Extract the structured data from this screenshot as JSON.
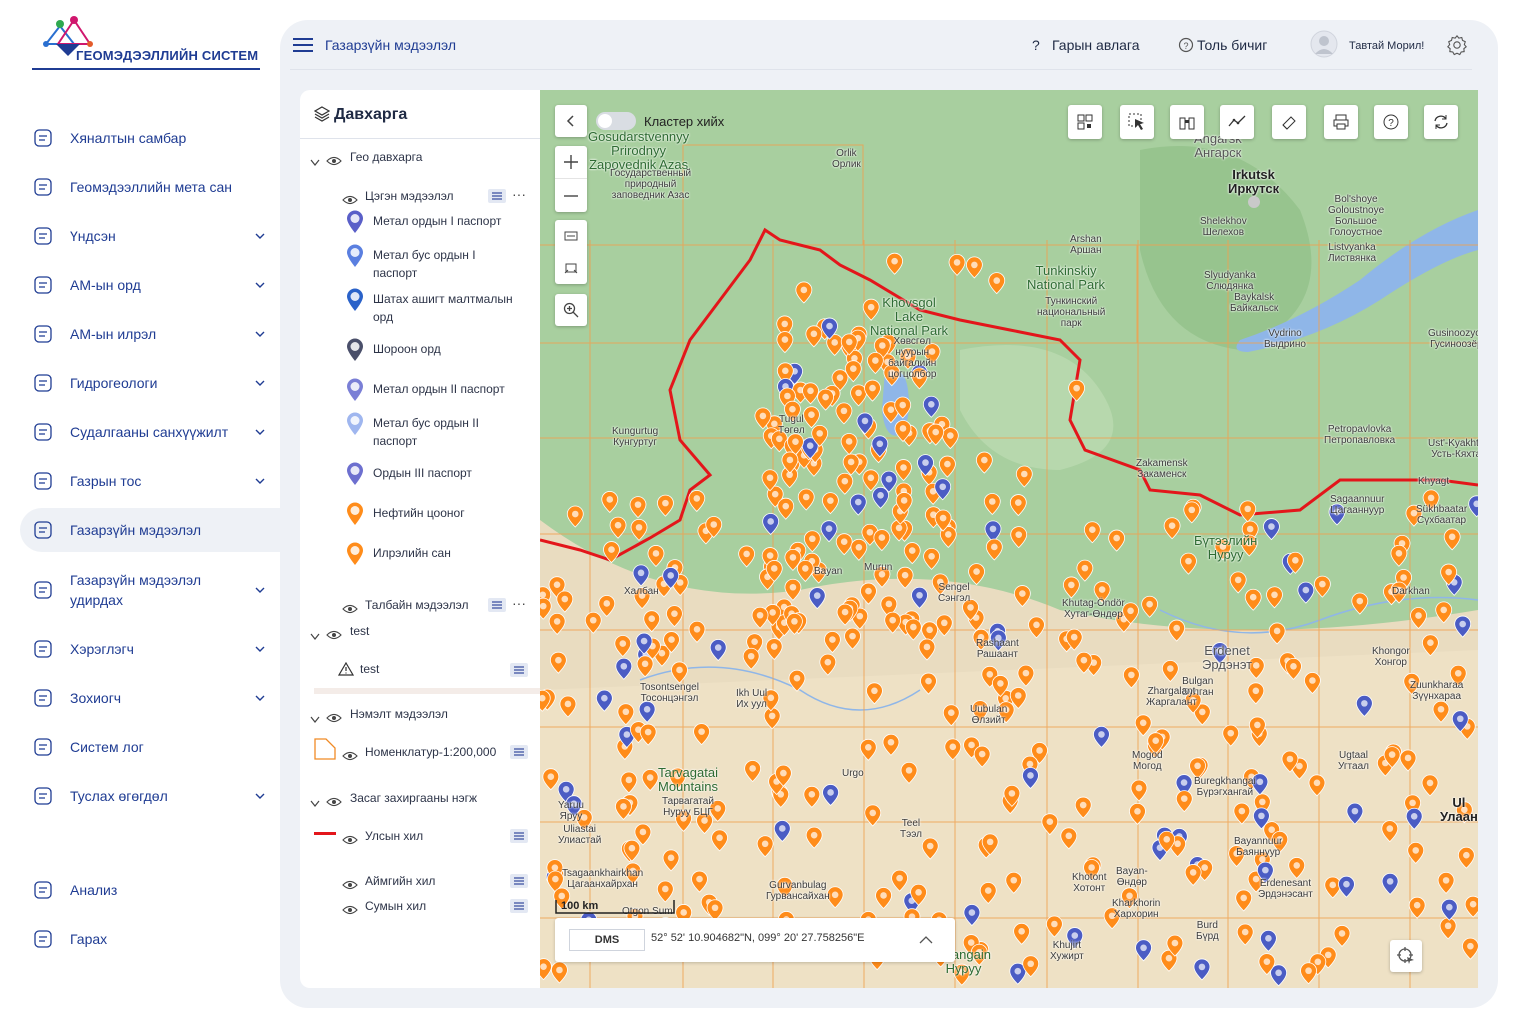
{
  "app": {
    "logo_text": "ГЕОМЭДЭЭЛЛИЙН СИСТЕМ"
  },
  "sidebar": {
    "items": [
      {
        "label": "Хяналтын самбар",
        "icon": "dashboard-icon",
        "chevron": false
      },
      {
        "label": "Геомэдээллийн мета сан",
        "icon": "database-icon",
        "chevron": false
      },
      {
        "label": "Үндсэн",
        "icon": "pages-icon",
        "chevron": true
      },
      {
        "label": "АМ-ын орд",
        "icon": "map-edit-icon",
        "chevron": true
      },
      {
        "label": "АМ-ын илрэл",
        "icon": "map-edit-icon",
        "chevron": true
      },
      {
        "label": "Гидрогеологи",
        "icon": "map-edit-icon",
        "chevron": true
      },
      {
        "label": "Судалгааны санхүүжилт",
        "icon": "map-edit-icon",
        "chevron": true
      },
      {
        "label": "Газрын тос",
        "icon": "map-edit-icon",
        "chevron": true
      },
      {
        "label": "Газарзүйн мэдээлэл",
        "icon": "location-icon",
        "chevron": false,
        "active": true
      },
      {
        "label": "Газарзүйн мэдээлэл удирдах",
        "icon": "location-icon",
        "chevron": true
      },
      {
        "label": "Хэрэглэгч",
        "icon": "user-icon",
        "chevron": true
      },
      {
        "label": "Зохиогч",
        "icon": "folder-icon",
        "chevron": true
      },
      {
        "label": "Систем лог",
        "icon": "eye-icon",
        "chevron": false
      },
      {
        "label": "Туслах өгөгдөл",
        "icon": "document-icon",
        "chevron": true
      },
      {
        "label": "Анализ",
        "icon": "pie-chart-icon",
        "chevron": false
      },
      {
        "label": "Гарах",
        "icon": "logout-icon",
        "chevron": false
      }
    ]
  },
  "header": {
    "breadcrumb": "Газарзүйн мэдээлэл",
    "help": "Гарын авлага",
    "dictionary": "Толь бичиг",
    "welcome": "Тавтай Морил!"
  },
  "layers": {
    "title": "Давхарга",
    "geo_group": "Гео давхарга",
    "blue_info": "Цэгэн мэдээлэл",
    "items": [
      {
        "label": "Метал ордын I паспорт",
        "color": "#5a5fc8"
      },
      {
        "label": "Метал бус ордын I паспорт",
        "color": "#5a7fe0"
      },
      {
        "label": "Шатах ашигт малтмалын орд",
        "color": "#2a62c9"
      },
      {
        "label": "Шороон орд",
        "color": "#4a4f6a"
      },
      {
        "label": "Метал ордын II паспорт",
        "color": "#7a7fd6"
      },
      {
        "label": "Метал бус ордын II паспорт",
        "color": "#9fb6ef"
      },
      {
        "label": "Ордын III паспорт",
        "color": "#6d6fcf"
      },
      {
        "label": "Нефтийн цооног",
        "color": "#ff8c1a"
      },
      {
        "label": "Илрэлийн сан",
        "color": "#ff8c1a"
      }
    ],
    "field_info": "Талбайн мэдээлэл",
    "test_group": "test",
    "test_item": "test",
    "extra_group": "Нэмэлт мэдээлэл",
    "nomenclature": "Номенклатур-1:200,000",
    "admin_group": "Засаг захиргааны нэгж",
    "state_border": "Улсын хил",
    "aimag_border": "Аймгийн хил",
    "sum_border": "Сумын хил"
  },
  "map": {
    "cluster_label": "Кластер хийх",
    "scale_label": "100 km",
    "dms_button": "DMS",
    "coordinates": "52° 52' 10.904682\"N, 099° 20' 27.758256\"E",
    "colors": {
      "accent": "#1f3c93",
      "marker_orange": "#ff8c1a",
      "marker_blue": "#4b5cc4",
      "border_red": "#e3161b"
    },
    "labels": {
      "gosudarstvenny": "Gosudarstvennyy\nPrirodnyy\nZapovednik Azas",
      "gos_ru": "Государственный\nприродный\nзаповедник Азас",
      "orlik": "Orlik\nОрлик",
      "angarsk": "Angarsk\nАнгарск",
      "irkutsk": "Irkutsk\nИркутск",
      "shelekhov": "Shelekhov\nШелехов",
      "bolshoye": "Bol'shoye\nGoloustnoye\nБольшое\nГолоустное",
      "arshan": "Arshan\nАршан",
      "tunkinsky": "Tunkinskiy\nNational Park",
      "tunkinsky_ru": "Тункинский\nнациональный\nпарк",
      "listvyanka": "Listvyanka\nЛиствянка",
      "slyudyanka": "Slyudyanka\nСлюдянка",
      "baykalsk": "Baykalsk\nБайкальск",
      "vydrino": "Vydrino\nВыдрино",
      "gusinoozyorsk": "Gusinoozyorsk\nГусиноозёрск",
      "khovsgol": "Khovsgol\nLake\nNational Park",
      "khovsgol_mn": "Хөвсгөл\nнуурын\nбайгалийн\nцогцолбор",
      "kungurtug": "Kungurtug\nКунгуртуг",
      "zakamensk": "Zakamensk\nЗакаменск",
      "petropavlovka": "Petropavlovka\nПетропавловка",
      "ust_kyakhta": "Ust'-Kyakhta\nУсть-Кяхта",
      "khyagt": "Khyagt",
      "sukhbaatar": "Sükhbaatar\nСүхбаатар",
      "butaeliin": "Бүтээлийн\nНуруу",
      "tarvagatai": "Tarvagatai\nMountains",
      "tarvagatai_mn": "Тарвагатай\nНуруу БЦГ",
      "erdenet": "Erdenet\nЭрдэнэт",
      "bulgan": "Bulgan\nБулган",
      "uliastai": "Uliastai\nУлиастай",
      "tsagaankhairkhan": "Tsagaankhairkhan\nЦагаанхайрхан",
      "tosontsengel": "Tosontsengel\nТосонцэнгэл",
      "ikh_uul": "Ikh Uul\nИх уул",
      "murun": "Murun",
      "bayan": "Bayan",
      "khalban": "Халбан",
      "tugul": "Tugul\nТөгөл",
      "sengel": "Sengel\nСэнгэл",
      "khutag": "Khutag-Öndör\nХутаг-Өндөр",
      "rashaant": "Rashaant\nРашаант",
      "uubulan": "Uubulan\nӨлзийт",
      "mogod": "Mogod\nМогод",
      "burgekhangai": "Buregkhangai\nБүрэгхангай",
      "bayannuur": "Bayannuur\nБаяннуур",
      "ugtaal": "Ugtaal\nУгтаал",
      "zuunkharaa": "Zuunkharaa\nЗүүнхараа",
      "khotont": "Khotont\nХотонт",
      "erdenesant": "Erdenesant\nЭрдэнэсант",
      "burd": "Burd\nБүрд",
      "zhargalant": "Zhargalant\nЖаргалант",
      "khujirt": "Khujirt\nХужирт",
      "kharkhorin": "Kharkhorin\nХархорин",
      "gurvanbulag": "Gurvanbulag\nГурвансайхан",
      "otgon": "Otgon Sum",
      "yaruu": "Yaruu\nЯруу",
      "teel": "Teel\nТээл",
      "khangain": "Khangain\nНуруу",
      "sagaannuur": "Sagaannuur\nЦагааннуур",
      "darkhan": "Darkhan",
      "ulaan": "Ul\nУлаан",
      "khongor": "Khongor\nХонгор",
      "bayan_undur": "Bayan-\nӨндөр",
      "urgo": "Urgo"
    }
  }
}
